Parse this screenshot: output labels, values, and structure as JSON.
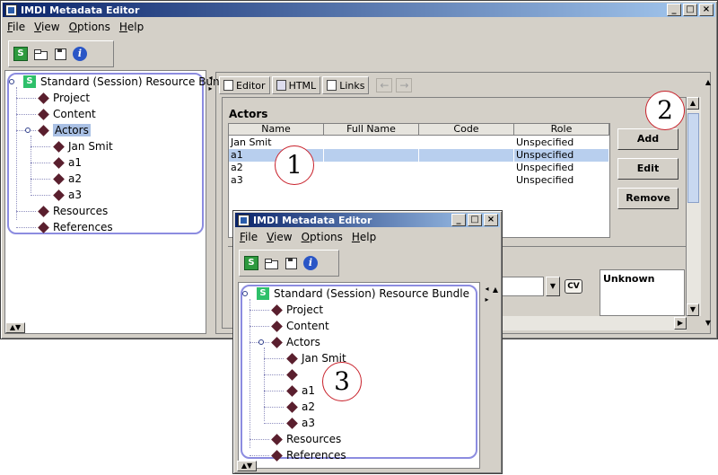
{
  "main_window": {
    "title": "IMDI Metadata Editor",
    "menu": [
      "File",
      "View",
      "Options",
      "Help"
    ],
    "toolbar_icons": [
      "new-session-icon",
      "open-folder-icon",
      "save-icon",
      "info-icon"
    ],
    "tree": [
      {
        "label": "Standard (Session) Resource Bundle",
        "level": 0
      },
      {
        "label": "Project",
        "level": 1
      },
      {
        "label": "Content",
        "level": 1
      },
      {
        "label": "Actors",
        "level": 1,
        "selected": true
      },
      {
        "label": "Jan Smit",
        "level": 2
      },
      {
        "label": "a1",
        "level": 2
      },
      {
        "label": "a2",
        "level": 2
      },
      {
        "label": "a3",
        "level": 2
      },
      {
        "label": "Resources",
        "level": 1
      },
      {
        "label": "References",
        "level": 1
      }
    ],
    "tabs": [
      "Editor",
      "HTML",
      "Links"
    ],
    "actors": {
      "title": "Actors",
      "columns": [
        "Name",
        "Full Name",
        "Code",
        "Role"
      ],
      "rows": [
        {
          "name": "Jan Smit",
          "full_name": "",
          "code": "",
          "role": "Unspecified"
        },
        {
          "name": "a1",
          "full_name": "",
          "code": "",
          "role": "Unspecified",
          "selected": true
        },
        {
          "name": "a2",
          "full_name": "",
          "code": "",
          "role": "Unspecified"
        },
        {
          "name": "a3",
          "full_name": "",
          "code": "",
          "role": "Unspecified"
        }
      ],
      "buttons": {
        "add": "Add",
        "edit": "Edit",
        "remove": "Remove"
      }
    },
    "cv_label": "CV",
    "unknown_value": "Unknown"
  },
  "popup_window": {
    "title": "IMDI Metadata Editor",
    "menu": [
      "File",
      "View",
      "Options",
      "Help"
    ],
    "tree": [
      {
        "label": "Standard (Session) Resource Bundle",
        "level": 0
      },
      {
        "label": "Project",
        "level": 1
      },
      {
        "label": "Content",
        "level": 1
      },
      {
        "label": "Actors",
        "level": 1
      },
      {
        "label": "Jan Smit",
        "level": 2
      },
      {
        "label": "",
        "level": 2
      },
      {
        "label": "a1",
        "level": 2
      },
      {
        "label": "a2",
        "level": 2
      },
      {
        "label": "a3",
        "level": 2
      },
      {
        "label": "Resources",
        "level": 1
      },
      {
        "label": "References",
        "level": 1
      }
    ]
  },
  "callouts": [
    "1",
    "2",
    "3"
  ],
  "colors": {
    "titlebar_start": "#0a246a",
    "titlebar_end": "#a6caf0",
    "callout_border": "#c8202a",
    "tree_node": "#5a1f2e",
    "selection": "#b8cfee"
  }
}
